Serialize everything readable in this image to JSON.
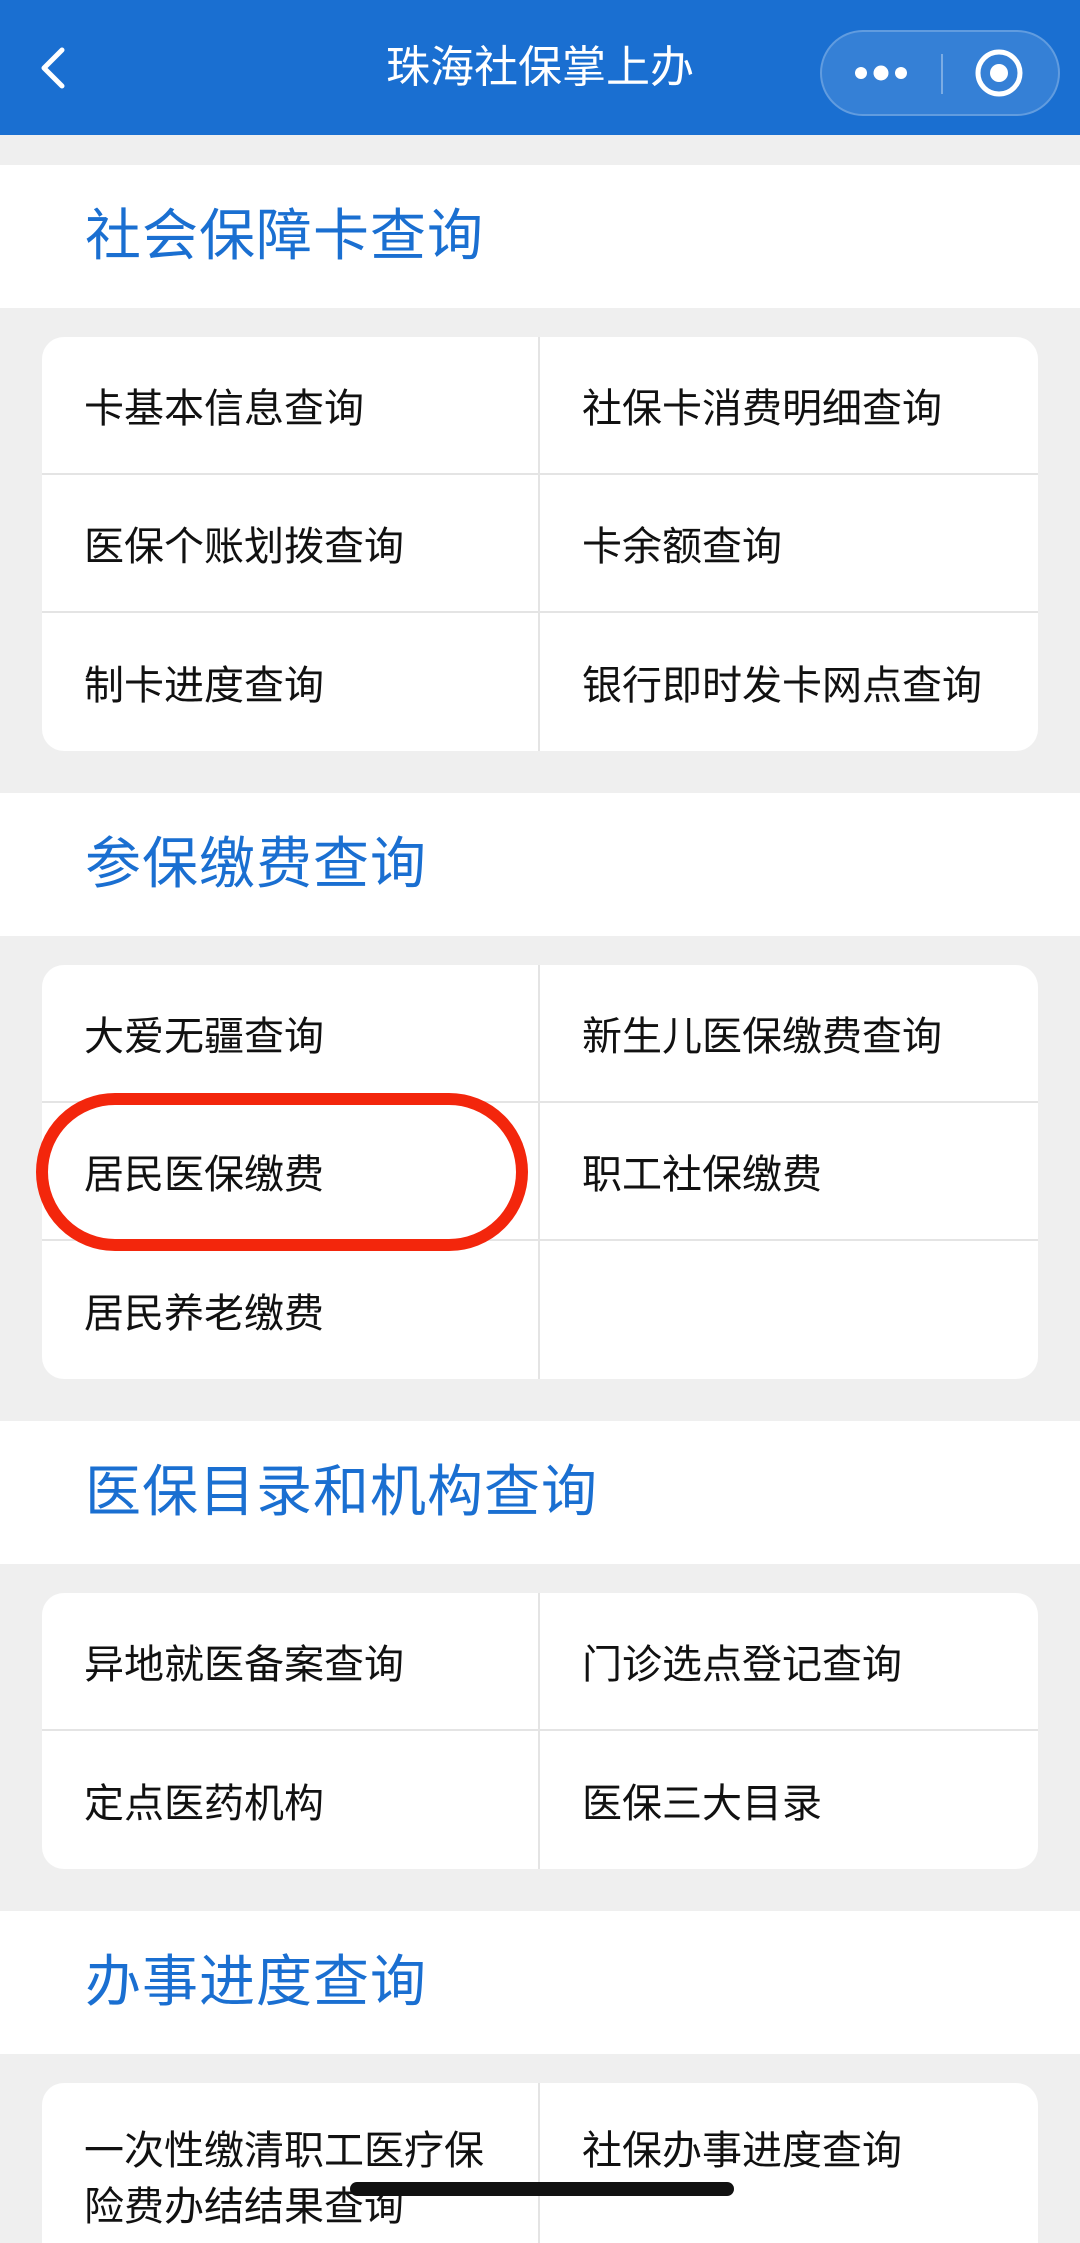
{
  "navbar": {
    "title": "珠海社保掌上办",
    "back_icon": "chevron-left-icon",
    "more_icon": "more-dots-icon",
    "close_icon": "target-circle-icon",
    "color": "#1a6fd1"
  },
  "sections": [
    {
      "title": "社会保障卡查询",
      "rows": [
        [
          "卡基本信息查询",
          "社保卡消费明细查询"
        ],
        [
          "医保个账划拨查询",
          "卡余额查询"
        ],
        [
          "制卡进度查询",
          "银行即时发卡网点查询"
        ]
      ]
    },
    {
      "title": "参保缴费查询",
      "rows": [
        [
          "大爱无疆查询",
          "新生儿医保缴费查询"
        ],
        [
          "居民医保缴费",
          "职工社保缴费"
        ],
        [
          "居民养老缴费",
          ""
        ]
      ]
    },
    {
      "title": "医保目录和机构查询",
      "rows": [
        [
          "异地就医备案查询",
          "门诊选点登记查询"
        ],
        [
          "定点医药机构",
          "医保三大目录"
        ]
      ]
    },
    {
      "title": "办事进度查询",
      "rows": [
        [
          "一次性缴清职工医疗保险费办结结果查询",
          "社保办事进度查询"
        ]
      ]
    }
  ],
  "highlight_color": "#f3260c"
}
